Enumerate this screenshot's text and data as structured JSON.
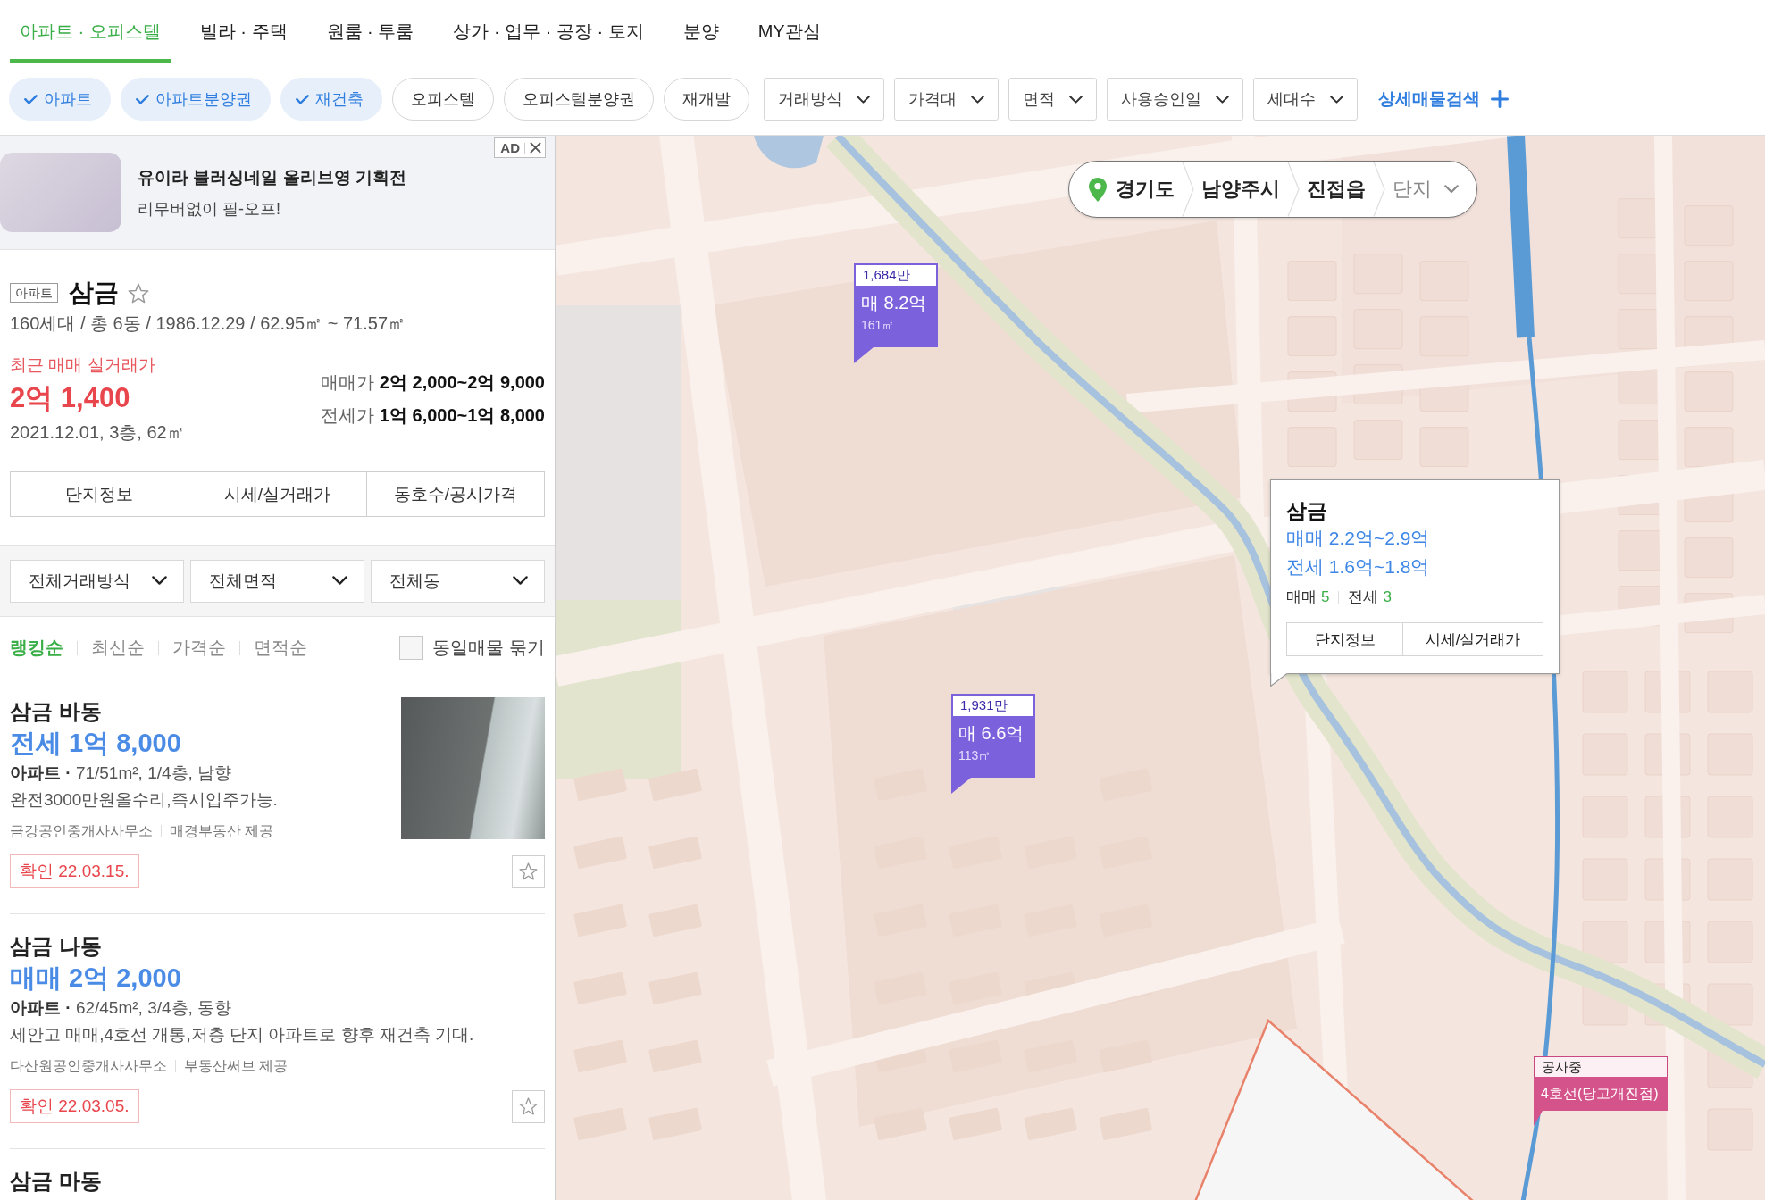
{
  "nav_tabs": [
    {
      "label": "아파트 · 오피스텔",
      "selected": true
    },
    {
      "label": "빌라 · 주택",
      "selected": false
    },
    {
      "label": "원룸 · 투룸",
      "selected": false
    },
    {
      "label": "상가 · 업무 · 공장 · 토지",
      "selected": false
    },
    {
      "label": "분양",
      "selected": false
    },
    {
      "label": "MY관심",
      "selected": false
    }
  ],
  "filters": {
    "chips": [
      {
        "label": "아파트",
        "selected": true
      },
      {
        "label": "아파트분양권",
        "selected": true
      },
      {
        "label": "재건축",
        "selected": true
      },
      {
        "label": "오피스텔",
        "selected": false
      },
      {
        "label": "오피스텔분양권",
        "selected": false
      },
      {
        "label": "재개발",
        "selected": false
      }
    ],
    "dropdowns": [
      "거래방식",
      "가격대",
      "면적",
      "사용승인일",
      "세대수"
    ],
    "detail_search": "상세매물검색"
  },
  "ad": {
    "badge": "AD",
    "title": "유이라 블러싱네일 올리브영 기획전",
    "subtitle": "리무버없이 필-오프!"
  },
  "complex": {
    "type_tag": "아파트",
    "name": "삼금",
    "favorite": false,
    "summary": "160세대 / 총 6동 / 1986.12.29 / 62.95㎡ ~ 71.57㎡",
    "recent_label": "최근 매매 실거래가",
    "recent_price": "2억 1,400",
    "recent_detail": "2021.12.01, 3층, 62㎡",
    "price_ranges": [
      "매매가 **2억 2,000~2억 9,000**",
      "전세가 **1억 6,000~1억 8,000**"
    ],
    "buttons": [
      "단지정보",
      "시세/실거래가",
      "동호수/공시가격"
    ]
  },
  "list_filters": [
    "전체거래방식",
    "전체면적",
    "전체동"
  ],
  "sort_options": [
    {
      "label": "랭킹순",
      "selected": true
    },
    {
      "label": "최신순",
      "selected": false
    },
    {
      "label": "가격순",
      "selected": false
    },
    {
      "label": "면적순",
      "selected": false
    }
  ],
  "group_same": {
    "label": "동일매물 묶기",
    "checked": false
  },
  "listings": [
    {
      "title": "삼금 바동",
      "price": "전세 1억 8,000",
      "specs": "**아파트 ·** 71/51m², 1/4층, 남향",
      "description": "완전3000만원올수리,즉시입주가능.",
      "agency": "금강공인중개사사무소",
      "provider": "매경부동산 제공",
      "confirmed": "확인 22.03.15.",
      "has_photo": true,
      "favorite": false
    },
    {
      "title": "삼금 나동",
      "price": "매매 2억 2,000",
      "specs": "**아파트 ·** 62/45m², 3/4층, 동향",
      "description": "세안고 매매,4호선 개통,저층 단지 아파트로 향후 재건축 기대.",
      "agency": "다산원공인중개사사무소",
      "provider": "부동산써브 제공",
      "confirmed": "확인 22.03.05.",
      "favorite": false
    },
    {
      "title": "삼금 마동"
    }
  ],
  "map": {
    "breadcrumb": [
      "경기도",
      "남양주시",
      "진접읍"
    ],
    "level_select": "단지",
    "markers": [
      {
        "unit_price": "1,684만",
        "price": "매 8.2억",
        "area": "161㎡"
      },
      {
        "unit_price": "1,931만",
        "price": "매 6.6억",
        "area": "113㎡"
      }
    ],
    "popup": {
      "title": "삼금",
      "sale_range": "매매 2.2억~2.9억",
      "lease_range": "전세 1.6억~1.8억",
      "counts": [
        {
          "label": "매매",
          "value": "5"
        },
        {
          "label": "전세",
          "value": "3"
        }
      ],
      "buttons": [
        "단지정보",
        "시세/실거래가"
      ]
    },
    "construction": {
      "status": "공사중",
      "line": "4호선(당고개진접)"
    }
  }
}
